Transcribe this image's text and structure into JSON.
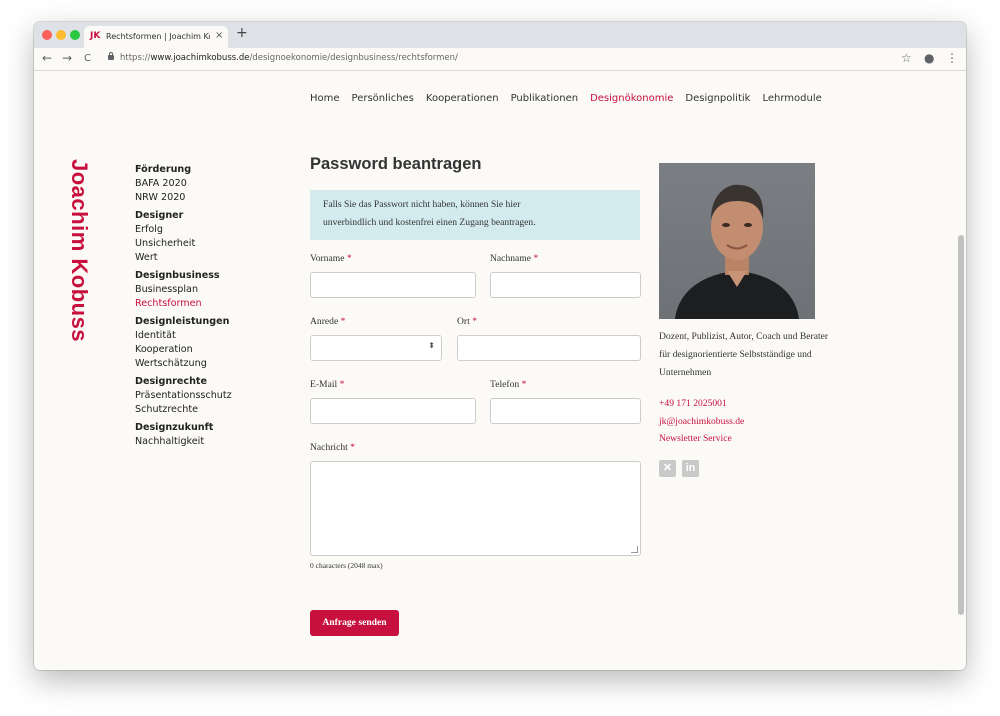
{
  "browser": {
    "tab_favicon": "JK",
    "tab_title": "Rechtsformen | Joachim Kobuss",
    "tab_close": "×",
    "new_tab": "+",
    "url_scheme": "https://",
    "url_host": "www.joachimkobuss.de",
    "url_path": "/designoekonomie/designbusiness/rechtsformen/",
    "back": "←",
    "forward": "→",
    "reload": "C",
    "bookmark": "☆",
    "account": "●",
    "menu": "⋮"
  },
  "brand": {
    "name": "Joachim Kobuss"
  },
  "topnav": [
    "Home",
    "Persönliches",
    "Kooperationen",
    "Publikationen",
    "Designökonomie",
    "Designpolitik",
    "Lehrmodule"
  ],
  "topnav_active": "Designökonomie",
  "sidenav": [
    {
      "heading": "Förderung",
      "items": [
        "BAFA 2020",
        "NRW 2020"
      ]
    },
    {
      "heading": "Designer",
      "items": [
        "Erfolg",
        "Unsicherheit",
        "Wert"
      ]
    },
    {
      "heading": "Designbusiness",
      "items": [
        "Businessplan",
        "Rechtsformen"
      ]
    },
    {
      "heading": "Designleistungen",
      "items": [
        "Identität",
        "Kooperation",
        "Wertschätzung"
      ]
    },
    {
      "heading": "Designrechte",
      "items": [
        "Präsentationsschutz",
        "Schutzrechte"
      ]
    },
    {
      "heading": "Designzukunft",
      "items": [
        "Nachhaltigkeit"
      ]
    }
  ],
  "sidenav_active": "Rechtsformen",
  "form": {
    "title": "Password beantragen",
    "alert_line1": "Falls Sie das Passwort nicht haben, können Sie hier",
    "alert_line2": "unverbindlich und kostenfrei einen Zugang beantragen.",
    "required_mark": "*",
    "fields": {
      "vorname": {
        "label": "Vorname",
        "value": ""
      },
      "nachname": {
        "label": "Nachname",
        "value": ""
      },
      "anrede": {
        "label": "Anrede",
        "value": ""
      },
      "ort": {
        "label": "Ort",
        "value": ""
      },
      "email": {
        "label": "E-Mail",
        "value": ""
      },
      "telefon": {
        "label": "Telefon",
        "value": ""
      },
      "nachricht": {
        "label": "Nachricht",
        "value": ""
      }
    },
    "select_arrow": "⬍",
    "counter": "0 characters (2048 max)",
    "submit": "Anfrage senden"
  },
  "profile": {
    "bio": "Dozent, Publizist, Autor, Coach und Berater für designorientierte Selbstständige und Unternehmen",
    "phone": "+49 171 2025001",
    "email": "jk@joachimkobuss.de",
    "newsletter": "Newsletter Service",
    "social": [
      {
        "name": "xing-icon",
        "glyph": "✕"
      },
      {
        "name": "linkedin-icon",
        "glyph": "in"
      }
    ]
  },
  "colors": {
    "accent": "#c8103e",
    "alert_bg": "#d3ebee",
    "page_bg": "#fbfaf7"
  }
}
